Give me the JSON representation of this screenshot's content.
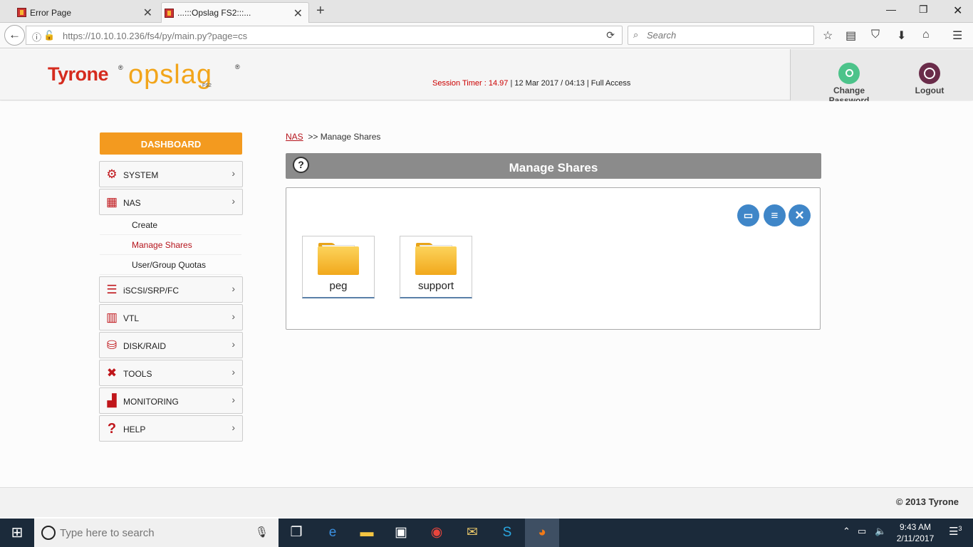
{
  "browser": {
    "tabs": [
      {
        "title": "Error Page"
      },
      {
        "title": "...:::Opslag FS2:::..."
      }
    ],
    "url_host": "https://10.10.10.236",
    "url_path": "/fs4/py/main.py?page=cs",
    "search_placeholder": "Search"
  },
  "header": {
    "brand1": "Tyrone",
    "brand2": "opslag",
    "brand_sub": "FS2",
    "reg": "®",
    "session_label": "Session Timer : 14.97",
    "session_rest": " | 12 Mar 2017 / 04:13 | Full Access",
    "change_password": "Change Password",
    "logout": "Logout"
  },
  "sidebar": {
    "dashboard": "DASHBOARD",
    "items": [
      {
        "label": "SYSTEM",
        "icon": "gear-icon"
      },
      {
        "label": "NAS",
        "icon": "nas-icon"
      },
      {
        "label": "iSCSI/SRP/FC",
        "icon": "server-icon"
      },
      {
        "label": "VTL",
        "icon": "tape-library-icon"
      },
      {
        "label": "DISK/RAID",
        "icon": "disk-icon"
      },
      {
        "label": "TOOLS",
        "icon": "tools-icon"
      },
      {
        "label": "MONITORING",
        "icon": "bar-chart-icon"
      },
      {
        "label": "HELP",
        "icon": "question-icon"
      }
    ],
    "nas_sub": [
      "Create",
      "Manage Shares",
      "User/Group Quotas"
    ],
    "active_sub": "Manage Shares"
  },
  "content": {
    "breadcrumb_link": "NAS",
    "breadcrumb_rest": ">> Manage Shares",
    "panel_title": "Manage Shares",
    "shares": [
      "peg",
      "support"
    ]
  },
  "footer": {
    "copyright": "© 2013 Tyrone"
  },
  "taskbar": {
    "search_placeholder": "Type here to search",
    "time": "9:43 AM",
    "date": "2/11/2017",
    "notifications": "3"
  },
  "colors": {
    "brand_red": "#d52b1e",
    "brand_orange": "#f39a1f",
    "panel_gray": "#8b8b8b",
    "action_blue": "#3f86c8"
  }
}
